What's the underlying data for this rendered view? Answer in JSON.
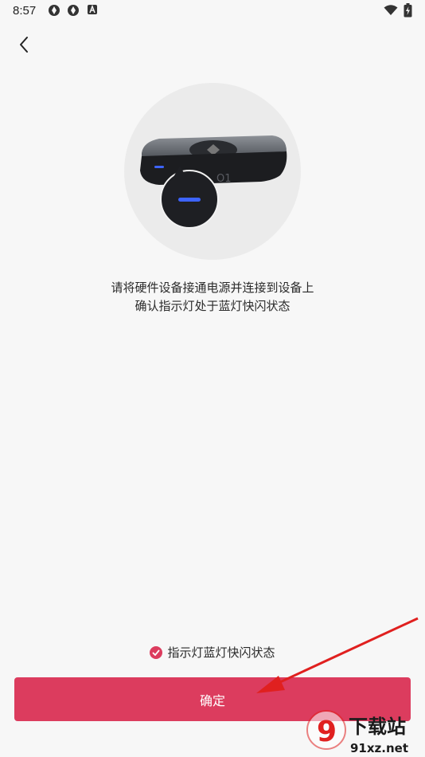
{
  "status_bar": {
    "time": "8:57",
    "icons": [
      "app-notification-icon",
      "app-notification-icon",
      "a-notification-icon",
      "wifi-icon",
      "battery-charging-icon"
    ]
  },
  "header": {
    "back_icon": "chevron-left-icon"
  },
  "illustration": {
    "device_label": "O1",
    "indicator_color": "#3d64ff",
    "circle_color": "#ebebeb"
  },
  "instructions": {
    "line1": "请将硬件设备接通电源并连接到设备上",
    "line2": "确认指示灯处于蓝灯快闪状态"
  },
  "confirm": {
    "checkbox_label": "指示灯蓝灯快闪状态",
    "checked": true,
    "button_label": "确定"
  },
  "colors": {
    "accent": "#dc3c5e",
    "background": "#f7f7f7"
  },
  "watermark": {
    "main": "下载站",
    "sub": "91xz.net",
    "logo": "9"
  }
}
